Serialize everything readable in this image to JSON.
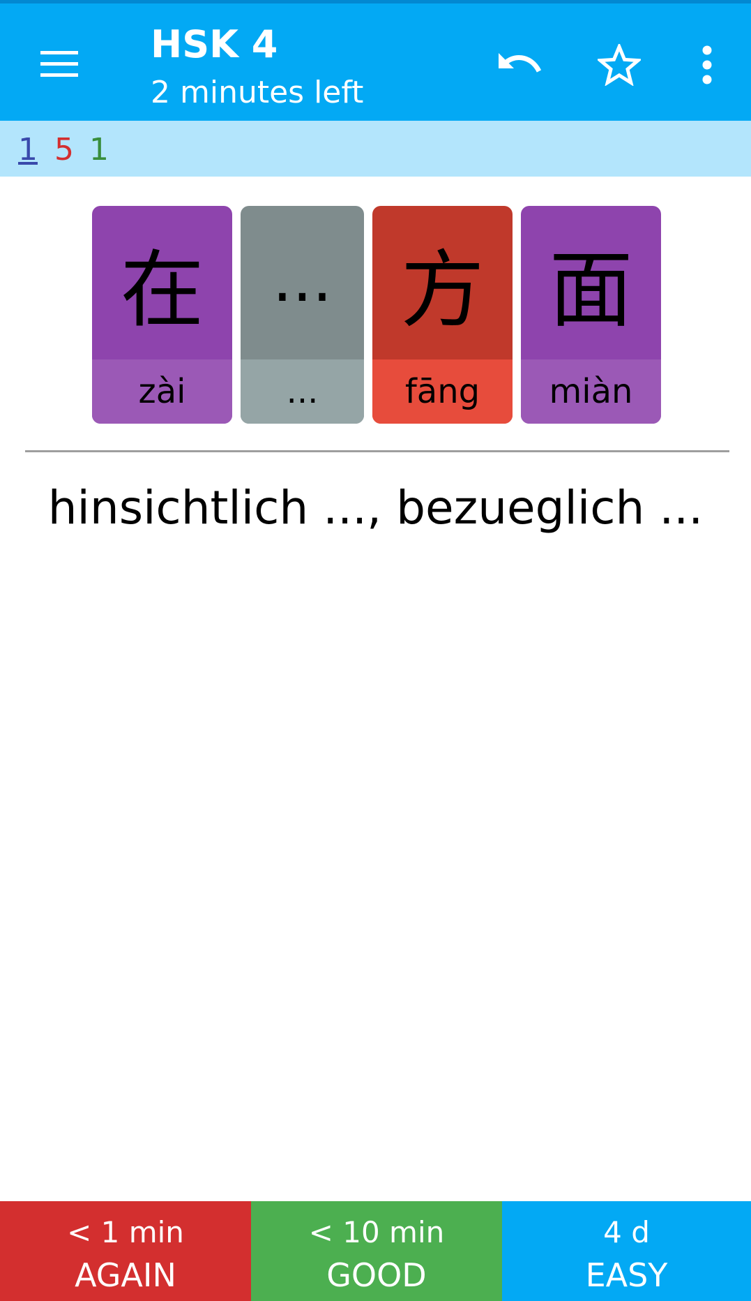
{
  "appbar": {
    "title": "HSK 4",
    "subtitle": "2 minutes left",
    "icons": {
      "menu": "menu-icon",
      "undo": "undo-icon",
      "star": "star-outline-icon",
      "more": "more-vert-icon"
    }
  },
  "counts": {
    "new": "1",
    "learning": "5",
    "review": "1"
  },
  "cards": [
    {
      "hanzi": "在",
      "pinyin": "zài"
    },
    {
      "hanzi": "...",
      "pinyin": "..."
    },
    {
      "hanzi": "方",
      "pinyin": "fāng"
    },
    {
      "hanzi": "面",
      "pinyin": "miàn"
    }
  ],
  "meaning": "hinsichtlich ..., bezueglich ...",
  "answers": [
    {
      "interval": "< 1 min",
      "label": "AGAIN"
    },
    {
      "interval": "< 10 min",
      "label": "GOOD"
    },
    {
      "interval": "4 d",
      "label": "EASY"
    }
  ],
  "colors": {
    "appbar": "#03a9f4",
    "counts_bar": "#b3e5fc",
    "tone_4": "#8e44ad",
    "tone_neutral": "#7f8c8d",
    "tone_1": "#c0392b",
    "again": "#d32f2f",
    "good": "#4caf50",
    "easy": "#03a9f4"
  }
}
